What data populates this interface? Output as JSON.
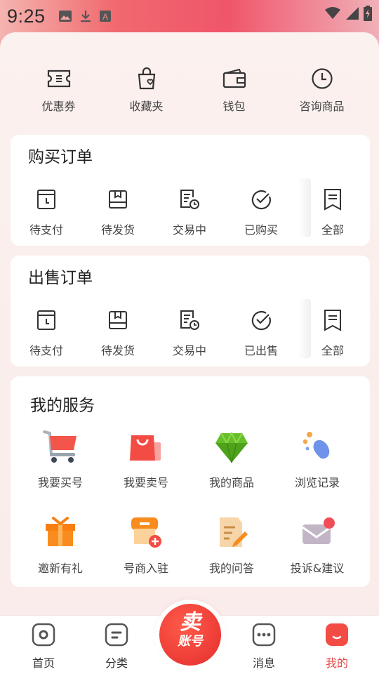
{
  "status_bar": {
    "time": "9:25"
  },
  "quick_links": [
    {
      "label": "优惠券",
      "icon": "coupon-icon"
    },
    {
      "label": "收藏夹",
      "icon": "favorites-bag-icon"
    },
    {
      "label": "钱包",
      "icon": "wallet-icon"
    },
    {
      "label": "咨询商品",
      "icon": "clock-icon"
    }
  ],
  "buy_orders": {
    "title": "购买订单",
    "items": [
      {
        "label": "待支付",
        "icon": "pending-payment-icon"
      },
      {
        "label": "待发货",
        "icon": "pending-shipment-icon"
      },
      {
        "label": "交易中",
        "icon": "in-transaction-icon"
      },
      {
        "label": "已购买",
        "icon": "check-circle-icon"
      },
      {
        "label": "全部",
        "icon": "all-orders-icon"
      }
    ]
  },
  "sell_orders": {
    "title": "出售订单",
    "items": [
      {
        "label": "待支付",
        "icon": "pending-payment-icon"
      },
      {
        "label": "待发货",
        "icon": "pending-shipment-icon"
      },
      {
        "label": "交易中",
        "icon": "in-transaction-icon"
      },
      {
        "label": "已出售",
        "icon": "check-circle-icon"
      },
      {
        "label": "全部",
        "icon": "all-orders-icon"
      }
    ]
  },
  "services": {
    "title": "我的服务",
    "items": [
      {
        "label": "我要买号",
        "icon": "shopping-cart-icon"
      },
      {
        "label": "我要卖号",
        "icon": "shopping-bag-icon"
      },
      {
        "label": "我的商品",
        "icon": "gem-icon"
      },
      {
        "label": "浏览记录",
        "icon": "history-icon"
      },
      {
        "label": "邀新有礼",
        "icon": "gift-icon"
      },
      {
        "label": "号商入驻",
        "icon": "store-icon"
      },
      {
        "label": "我的问答",
        "icon": "qa-notepad-icon"
      },
      {
        "label": "投诉&建议",
        "icon": "feedback-mail-icon"
      }
    ]
  },
  "tabbar": {
    "items": [
      {
        "label": "首页",
        "icon": "home-icon"
      },
      {
        "label": "分类",
        "icon": "category-icon"
      },
      {
        "label": "消息",
        "icon": "message-icon"
      },
      {
        "label": "我的",
        "icon": "profile-icon",
        "active": true
      }
    ],
    "center_line1": "卖",
    "center_line2": "账号"
  },
  "colors": {
    "accent": "#e84a4a",
    "page_bg": "#f8ece9"
  }
}
